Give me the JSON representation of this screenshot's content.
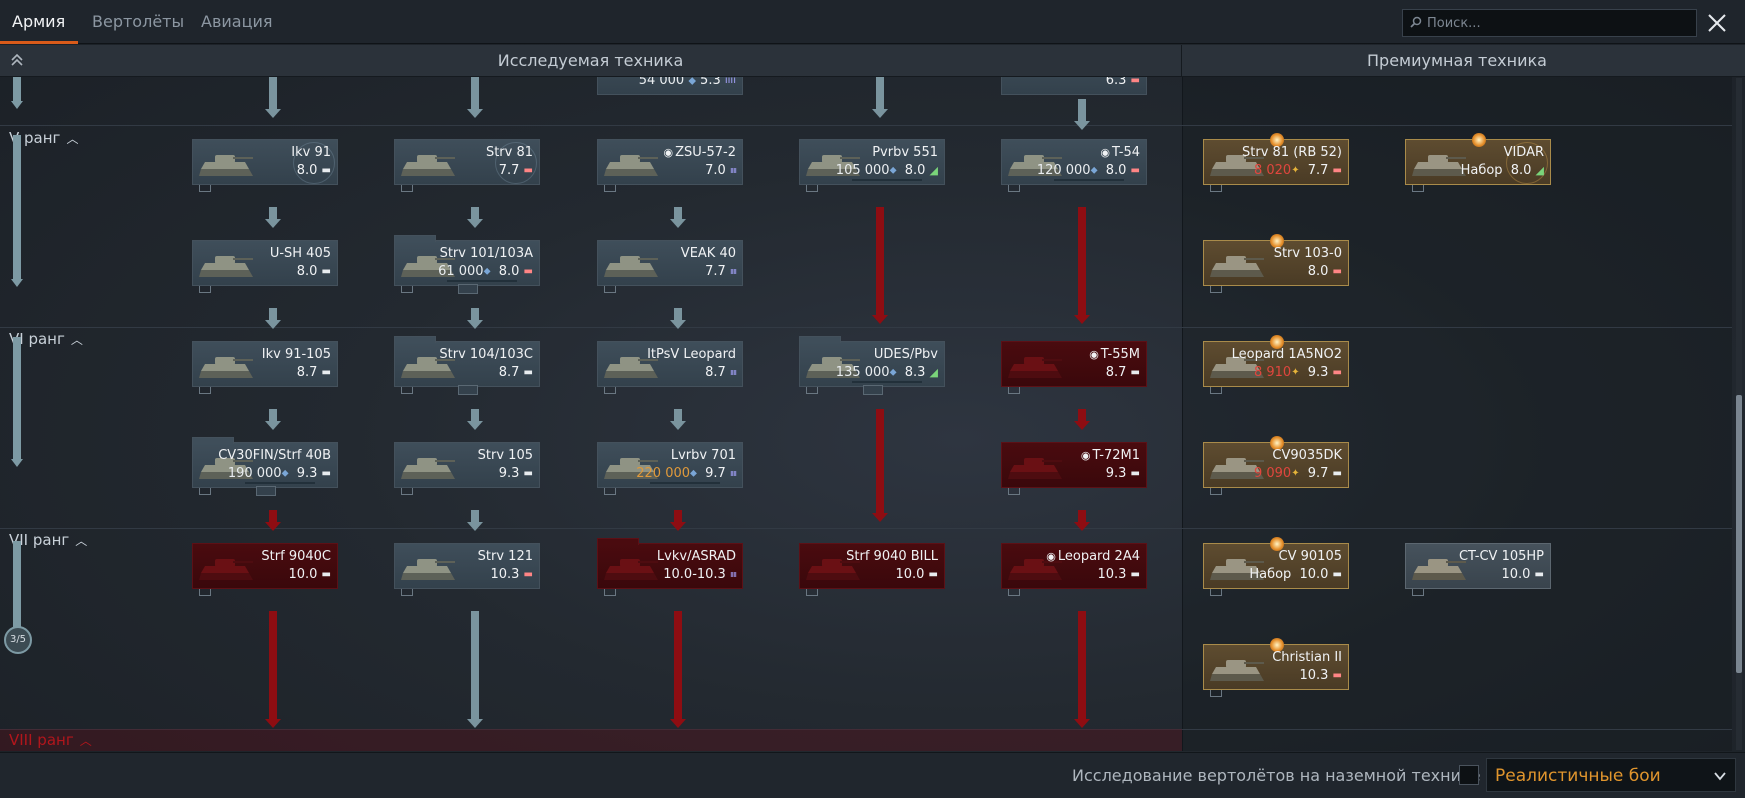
{
  "tabs": [
    {
      "label": "Армия",
      "active": true
    },
    {
      "label": "Вертолёты",
      "active": false
    },
    {
      "label": "Авиация",
      "active": false
    }
  ],
  "search": {
    "placeholder": "Поиск..."
  },
  "columns": {
    "researched": "Исследуемая техника",
    "premium": "Премиумная техника"
  },
  "ranks": [
    {
      "label": "V ранг",
      "locked": false
    },
    {
      "label": "VI ранг",
      "locked": false
    },
    {
      "label": "VII ранг",
      "locked": false
    },
    {
      "label": "VIII ранг",
      "locked": true
    }
  ],
  "progress": "3/5",
  "top_partial": [
    {
      "id": "c3_top",
      "line2": "54 000",
      "br": "5.3"
    },
    {
      "id": "c5_top",
      "line2": "",
      "br": "6.3"
    }
  ],
  "vehicles": {
    "c1_r5a": {
      "name": "Ikv 91",
      "rp": "",
      "br": "8.0",
      "state": "researched"
    },
    "c2_r5a": {
      "name": "Strv 81",
      "rp": "",
      "br": "7.7",
      "state": "researched"
    },
    "c3_r5a": {
      "name": "ZSU-57-2",
      "rp": "",
      "br": "7.0",
      "state": "researched"
    },
    "c4_r5a": {
      "name": "Pvrbv 551",
      "rp": "105 000",
      "br": "8.0",
      "state": "researching"
    },
    "c5_r5a": {
      "name": "T-54",
      "rp": "120 000",
      "br": "8.0",
      "state": "researching"
    },
    "c1_r5b": {
      "name": "U-SH 405",
      "rp": "",
      "br": "8.0",
      "state": "researched"
    },
    "c2_r5b": {
      "name": "Strv 101/103A",
      "rp": "61 000",
      "br": "8.0",
      "state": "researching"
    },
    "c3_r5b": {
      "name": "VEAK 40",
      "rp": "",
      "br": "7.7",
      "state": "researched"
    },
    "c1_r6a": {
      "name": "Ikv 91-105",
      "rp": "",
      "br": "8.7",
      "state": "researched"
    },
    "c2_r6a": {
      "name": "Strv 104/103C",
      "rp": "",
      "br": "8.7",
      "state": "researched"
    },
    "c3_r6a": {
      "name": "ItPsV Leopard",
      "rp": "",
      "br": "8.7",
      "state": "researched"
    },
    "c4_r6a": {
      "name": "UDES/Pbv",
      "rp": "135 000",
      "br": "8.3",
      "state": "researching"
    },
    "c5_r6a": {
      "name": "T-55M",
      "rp": "",
      "br": "8.7",
      "state": "locked"
    },
    "c1_r6b": {
      "name": "CV30FIN/Strf 40B",
      "rp": "190 000",
      "br": "9.3",
      "state": "researching"
    },
    "c2_r6b": {
      "name": "Strv 105",
      "rp": "",
      "br": "9.3",
      "state": "researched"
    },
    "c3_r6b": {
      "name": "Lvrbv 701",
      "rp": "220 000",
      "br": "9.7",
      "state": "researching"
    },
    "c5_r6b": {
      "name": "T-72M1",
      "rp": "",
      "br": "9.3",
      "state": "locked"
    },
    "c1_r7a": {
      "name": "Strf 9040C",
      "rp": "",
      "br": "10.0",
      "state": "locked"
    },
    "c2_r7a": {
      "name": "Strv 121",
      "rp": "",
      "br": "10.3",
      "state": "researched"
    },
    "c3_r7a": {
      "name": "Lvkv/ASRAD",
      "rp": "",
      "br": "10.0-10.3",
      "state": "locked"
    },
    "c4_r7a": {
      "name": "Strf 9040 BILL",
      "rp": "",
      "br": "10.0",
      "state": "locked"
    },
    "c5_r7a": {
      "name": "Leopard 2A4",
      "rp": "",
      "br": "10.3",
      "state": "locked"
    }
  },
  "premium": {
    "p1_r5a": {
      "name": "Strv 81 (RB 52)",
      "ge": "8 020",
      "br": "7.7"
    },
    "p2_r5a": {
      "name": "VIDAR",
      "ge": "Набор",
      "br": "8.0"
    },
    "p1_r5b": {
      "name": "Strv 103-0",
      "ge": "",
      "br": "8.0"
    },
    "p1_r6a": {
      "name": "Leopard 1A5NO2",
      "ge": "8 910",
      "br": "9.3"
    },
    "p1_r6b": {
      "name": "CV9035DK",
      "ge": "9 090",
      "br": "9.7"
    },
    "p1_r7a": {
      "name": "CV 90105",
      "ge": "Набор",
      "br": "10.0"
    },
    "p2_r7a": {
      "name": "CT-CV 105HP",
      "ge": "",
      "br": "10.0"
    },
    "p1_r7b": {
      "name": "Christian II",
      "ge": "",
      "br": "10.3"
    }
  },
  "bottom": {
    "heli_label": "Исследование вертолётов на наземной технике",
    "mode": "Реалистичные бои"
  },
  "colors": {
    "accent": "#d95b1a",
    "locked": "#8e0d12",
    "premium_border": "#a98b4a",
    "mode_text": "#e0952d"
  }
}
